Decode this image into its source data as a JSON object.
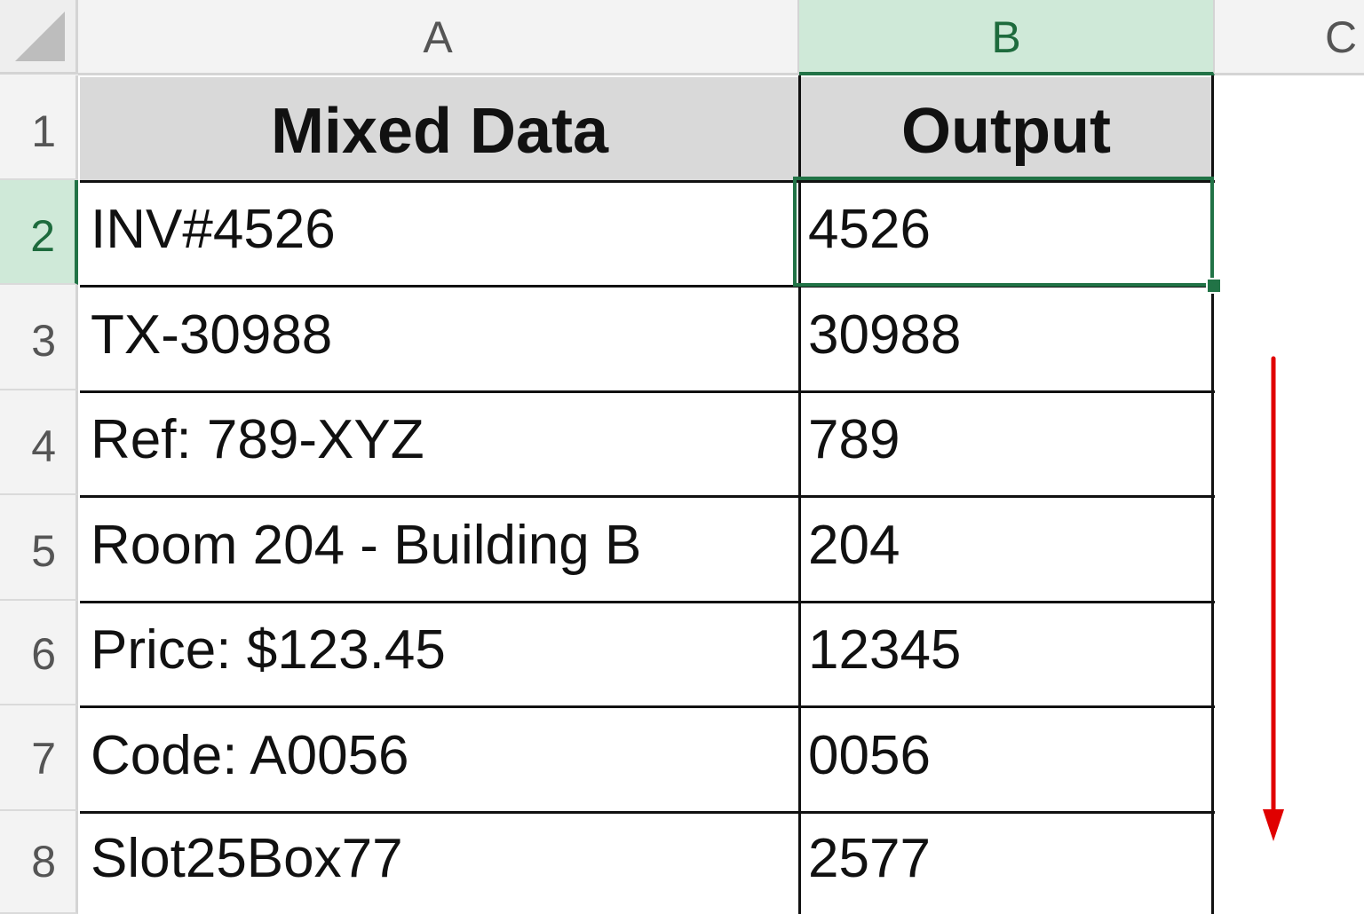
{
  "columns": {
    "corner": "",
    "a": "A",
    "b": "B",
    "c": "C"
  },
  "rows": [
    "1",
    "2",
    "3",
    "4",
    "5",
    "6",
    "7",
    "8"
  ],
  "headers": {
    "mixed_data": "Mixed Data",
    "output": "Output"
  },
  "data": [
    {
      "mixed": "INV#4526",
      "output": "4526"
    },
    {
      "mixed": "TX-30988",
      "output": "30988"
    },
    {
      "mixed": "Ref: 789-XYZ",
      "output": "789"
    },
    {
      "mixed": "Room 204 - Building B",
      "output": "204"
    },
    {
      "mixed": "Price: $123.45",
      "output": "12345"
    },
    {
      "mixed": "Code: A0056",
      "output": "0056"
    },
    {
      "mixed": "Slot25Box77",
      "output": "2577"
    }
  ],
  "selection": {
    "active_cell": "B2",
    "accent_color": "#217346"
  },
  "annotation": {
    "arrow_color": "#e00000",
    "arrow_icon": "down-arrow-icon"
  }
}
